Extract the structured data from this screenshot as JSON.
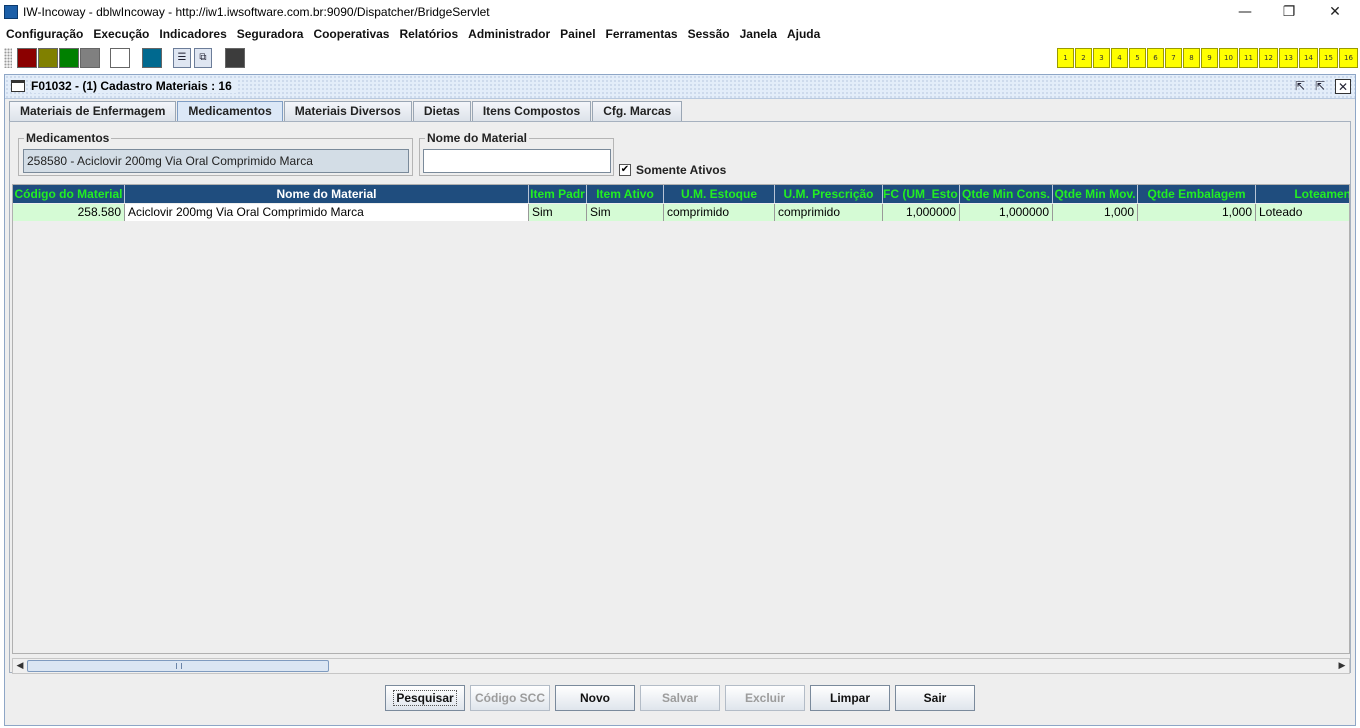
{
  "window": {
    "title": "IW-Incoway - dblwIncoway - http://iw1.iwsoftware.com.br:9090/Dispatcher/BridgeServlet"
  },
  "menu": [
    "Configuração",
    "Execução",
    "Indicadores",
    "Seguradora",
    "Cooperativas",
    "Relatórios",
    "Administrador",
    "Painel",
    "Ferramentas",
    "Sessão",
    "Janela",
    "Ajuda"
  ],
  "toolbar": {
    "swatches": [
      "#8b0000",
      "#808000",
      "#008000",
      "#808080",
      "#ffffff",
      "#00698f",
      "#3c3c3c"
    ],
    "numbers": [
      "1",
      "2",
      "3",
      "4",
      "5",
      "6",
      "7",
      "8",
      "9",
      "10",
      "11",
      "12",
      "13",
      "14",
      "15",
      "16"
    ]
  },
  "frame": {
    "title": "F01032 - (1) Cadastro Materiais : 16"
  },
  "tabs": [
    "Materiais de Enfermagem",
    "Medicamentos",
    "Materiais Diversos",
    "Dietas",
    "Itens Compostos",
    "Cfg. Marcas"
  ],
  "active_tab": "Medicamentos",
  "filters": {
    "medicamentos_label": "Medicamentos",
    "medicamentos_value": "258580 - Aciclovir  200mg  Via Oral  Comprimido    Marca",
    "nome_label": "Nome do Material",
    "nome_value": "",
    "somente_ativos_label": "Somente Ativos",
    "somente_ativos_checked": "✔"
  },
  "table": {
    "columns": [
      "Código do Material",
      "Nome do Material",
      "Item Padr",
      "Item Ativo",
      "U.M. Estoque",
      "U.M. Prescrição",
      "FC (UM_Esto",
      "Qtde Min Cons.",
      "Qtde Min Mov.",
      "Qtde Embalagem",
      "Loteamen"
    ],
    "rows": [
      {
        "codigo": "258.580",
        "nome": "Aciclovir  200mg  Via Oral  Comprimido    Marca",
        "item_padrao": "Sim",
        "item_ativo": "Sim",
        "um_estoque": "comprimido",
        "um_prescricao": "comprimido",
        "fc": "1,000000",
        "qtde_min_cons": "1,000000",
        "qtde_min_mov": "1,000",
        "qtde_embalagem": "1,000",
        "loteamento": "Loteado"
      }
    ]
  },
  "buttons": {
    "pesquisar": "Pesquisar",
    "codigo_scc": "Código SCC",
    "novo": "Novo",
    "salvar": "Salvar",
    "excluir": "Excluir",
    "limpar": "Limpar",
    "sair": "Sair"
  }
}
